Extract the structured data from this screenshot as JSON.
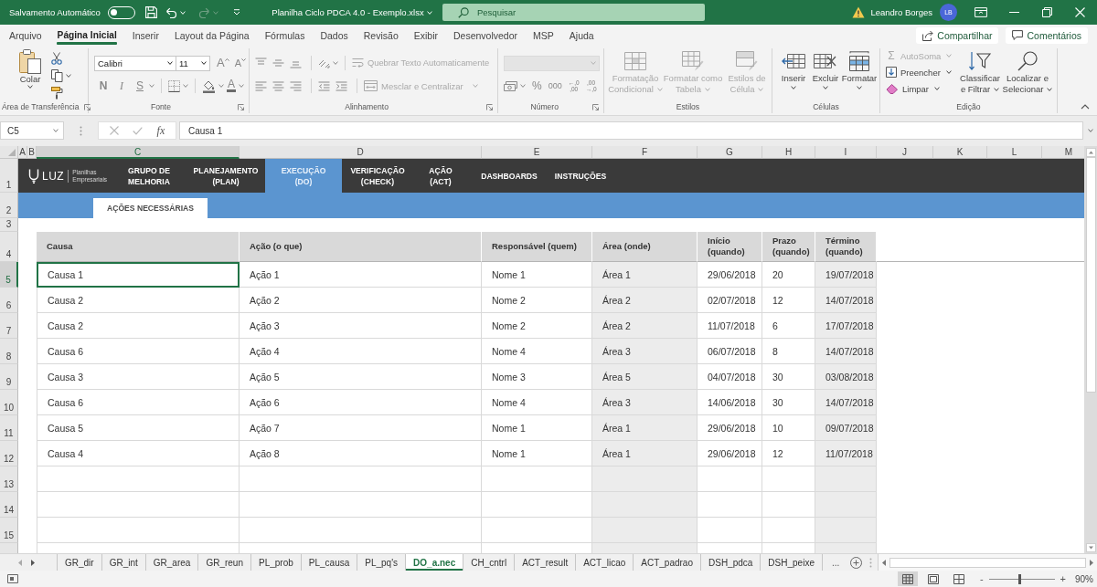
{
  "title_bar": {
    "autosave": {
      "label": "Salvamento Automático",
      "on": false
    },
    "document_title": "Planilha Ciclo PDCA 4.0 - Exemplo.xlsx",
    "search": {
      "placeholder": "Pesquisar"
    },
    "user": {
      "name": "Leandro Borges",
      "initials": "LB"
    }
  },
  "ribbon_tabs": [
    {
      "label": "Arquivo",
      "selected": false
    },
    {
      "label": "Página Inicial",
      "selected": true
    },
    {
      "label": "Inserir",
      "selected": false
    },
    {
      "label": "Layout da Página",
      "selected": false
    },
    {
      "label": "Fórmulas",
      "selected": false
    },
    {
      "label": "Dados",
      "selected": false
    },
    {
      "label": "Revisão",
      "selected": false
    },
    {
      "label": "Exibir",
      "selected": false
    },
    {
      "label": "Desenvolvedor",
      "selected": false
    },
    {
      "label": "MSP",
      "selected": false
    },
    {
      "label": "Ajuda",
      "selected": false
    }
  ],
  "ribbon_actions": [
    {
      "label": "Compartilhar",
      "kind": "share"
    },
    {
      "label": "Comentários",
      "kind": "comments"
    }
  ],
  "ribbon": {
    "clipboard": {
      "label": "Área de Transferência",
      "paste": "Colar"
    },
    "font": {
      "label": "Fonte",
      "font_name": "Calibri",
      "font_size": "11",
      "grow": "A",
      "shrink": "A",
      "bold": "N",
      "italic": "I",
      "underline": "S",
      "font_color": "A"
    },
    "alignment": {
      "label": "Alinhamento",
      "commands": [
        {
          "label": "Quebrar Texto Automaticamente",
          "kind": "wrap",
          "disabled": true
        },
        {
          "label": "Mesclar e Centralizar",
          "kind": "merge",
          "disabled": true
        }
      ]
    },
    "number": {
      "label": "Número",
      "percent": "%",
      "thousands": "000",
      "decimals": [
        {
          "top": "←,0",
          "bottom": ",00"
        },
        {
          "top": ",00",
          "bottom": "→,0"
        }
      ]
    },
    "styles": {
      "label": "Estilos",
      "buttons": [
        {
          "lines": [
            "Formatação",
            "Condicional"
          ],
          "kind": "conditional",
          "disabled": true
        },
        {
          "lines": [
            "Formatar como",
            "Tabela"
          ],
          "kind": "table",
          "disabled": true
        },
        {
          "lines": [
            "Estilos de",
            "Célula"
          ],
          "kind": "cell",
          "disabled": true
        }
      ]
    },
    "cells": {
      "label": "Células",
      "buttons": [
        {
          "label": "Inserir",
          "kind": "insert"
        },
        {
          "label": "Excluir",
          "kind": "delete"
        },
        {
          "label": "Formatar",
          "kind": "format"
        }
      ]
    },
    "editing": {
      "label": "Edição",
      "commands": [
        {
          "symbol": "Σ",
          "label": "AutoSoma",
          "kind": "autosum",
          "disabled": true
        },
        {
          "label": "Preencher",
          "kind": "fill",
          "disabled": false
        },
        {
          "label": "Limpar",
          "kind": "clear",
          "disabled": false
        }
      ],
      "buttons": [
        {
          "lines": [
            "Classificar",
            "e Filtrar"
          ],
          "kind": "sort"
        },
        {
          "lines": [
            "Localizar e",
            "Selecionar"
          ],
          "kind": "find"
        }
      ]
    }
  },
  "formula_bar": {
    "name_box": "C5",
    "function_label": "fx",
    "formula": "Causa 1"
  },
  "sheet": {
    "columns": [
      {
        "label": "A",
        "selected": false
      },
      {
        "label": "B",
        "selected": false
      },
      {
        "label": "C",
        "selected": true
      },
      {
        "label": "D",
        "selected": false
      },
      {
        "label": "E",
        "selected": false
      },
      {
        "label": "F",
        "selected": false
      },
      {
        "label": "G",
        "selected": false
      },
      {
        "label": "H",
        "selected": false
      },
      {
        "label": "I",
        "selected": false
      },
      {
        "label": "J",
        "selected": false
      },
      {
        "label": "K",
        "selected": false
      },
      {
        "label": "L",
        "selected": false
      },
      {
        "label": "M",
        "selected": false
      }
    ],
    "rows": [
      {
        "label": "1",
        "selected": false
      },
      {
        "label": "2",
        "selected": false
      },
      {
        "label": "3",
        "selected": false
      },
      {
        "label": "4",
        "selected": false
      },
      {
        "label": "5",
        "selected": true
      },
      {
        "label": "6",
        "selected": false
      },
      {
        "label": "7",
        "selected": false
      },
      {
        "label": "8",
        "selected": false
      },
      {
        "label": "9",
        "selected": false
      },
      {
        "label": "10",
        "selected": false
      },
      {
        "label": "11",
        "selected": false
      },
      {
        "label": "12",
        "selected": false
      },
      {
        "label": "13",
        "selected": false
      },
      {
        "label": "14",
        "selected": false
      },
      {
        "label": "15",
        "selected": false
      }
    ],
    "logo": {
      "name": "LUZ",
      "tagline": [
        "Planilhas",
        "Empresariais"
      ]
    },
    "nav": [
      {
        "lines": [
          "GRUPO DE",
          "MELHORIA"
        ],
        "selected": false
      },
      {
        "lines": [
          "PLANEJAMENTO",
          "(PLAN)"
        ],
        "selected": false
      },
      {
        "lines": [
          "EXECUÇÃO",
          "(DO)"
        ],
        "selected": true
      },
      {
        "lines": [
          "VERIFICAÇÃO",
          "(CHECK)"
        ],
        "selected": false
      },
      {
        "lines": [
          "AÇÃO",
          "(ACT)"
        ],
        "selected": false
      },
      {
        "lines": [
          "DASHBOARDS"
        ],
        "selected": false
      },
      {
        "lines": [
          "INSTRUÇÕES"
        ],
        "selected": false
      }
    ],
    "sub_tabs": [
      {
        "label": "AÇÕES NECESSÁRIAS",
        "selected": true
      }
    ],
    "table": {
      "columns": [
        "Causa",
        "Ação (o que)",
        "Responsável (quem)",
        "Área (onde)",
        "Início (quando)",
        "Prazo (quando)",
        "Término (quando)"
      ],
      "rows": [
        [
          "Causa 1",
          "Ação 1",
          "Nome 1",
          "Área 1",
          "29/06/2018",
          "20",
          "19/07/2018"
        ],
        [
          "Causa 2",
          "Ação 2",
          "Nome 2",
          "Área 2",
          "02/07/2018",
          "12",
          "14/07/2018"
        ],
        [
          "Causa 2",
          "Ação 3",
          "Nome 2",
          "Área 2",
          "11/07/2018",
          "6",
          "17/07/2018"
        ],
        [
          "Causa 6",
          "Ação 4",
          "Nome 4",
          "Área 3",
          "06/07/2018",
          "8",
          "14/07/2018"
        ],
        [
          "Causa 3",
          "Ação 5",
          "Nome 3",
          "Área 5",
          "04/07/2018",
          "30",
          "03/08/2018"
        ],
        [
          "Causa 6",
          "Ação 6",
          "Nome 4",
          "Área 3",
          "14/06/2018",
          "30",
          "14/07/2018"
        ],
        [
          "Causa 5",
          "Ação 7",
          "Nome 1",
          "Área 1",
          "29/06/2018",
          "10",
          "09/07/2018"
        ],
        [
          "Causa 4",
          "Ação 8",
          "Nome 1",
          "Área 1",
          "29/06/2018",
          "12",
          "11/07/2018"
        ]
      ]
    }
  },
  "sheet_tab_bar": {
    "tabs": [
      {
        "label": "GR_dir",
        "selected": false
      },
      {
        "label": "GR_int",
        "selected": false
      },
      {
        "label": "GR_area",
        "selected": false
      },
      {
        "label": "GR_reun",
        "selected": false
      },
      {
        "label": "PL_prob",
        "selected": false
      },
      {
        "label": "PL_causa",
        "selected": false
      },
      {
        "label": "PL_pq's",
        "selected": false
      },
      {
        "label": "DO_a.nec",
        "selected": true
      },
      {
        "label": "CH_cntrl",
        "selected": false
      },
      {
        "label": "ACT_result",
        "selected": false
      },
      {
        "label": "ACT_licao",
        "selected": false
      },
      {
        "label": "ACT_padrao",
        "selected": false
      },
      {
        "label": "DSH_pdca",
        "selected": false
      },
      {
        "label": "DSH_peixe",
        "selected": false
      }
    ],
    "more": "..."
  },
  "status_bar": {
    "views": [
      {
        "kind": "normal",
        "selected": true
      },
      {
        "kind": "page_layout",
        "selected": false
      },
      {
        "kind": "page_break",
        "selected": false
      }
    ],
    "zoom": {
      "minus": "-",
      "plus": "+",
      "level": 0.47,
      "reading": "90%"
    }
  }
}
